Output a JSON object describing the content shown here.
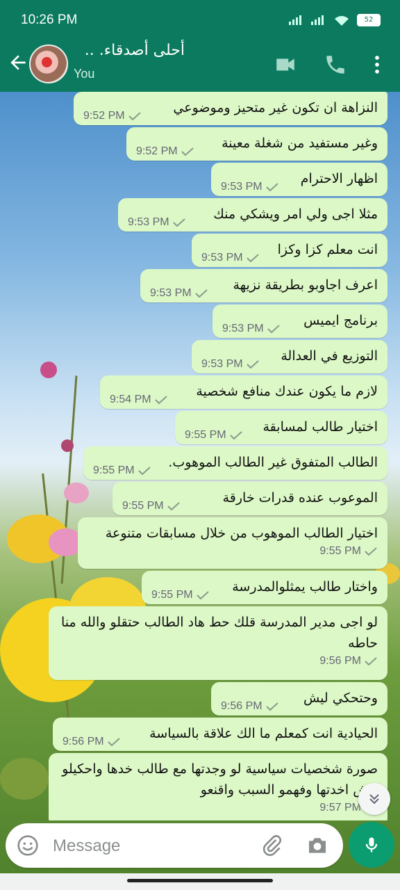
{
  "status": {
    "time": "10:26 PM",
    "battery": "52"
  },
  "header": {
    "title": "أحلى أصدقاء. ..",
    "subtitle": "You"
  },
  "messages": [
    {
      "text": "النزاهة ان تكون غير متحيز وموضوعي",
      "time": "9:52 PM"
    },
    {
      "text": "وغير مستفيد من شغلة معينة",
      "time": "9:52 PM"
    },
    {
      "text": "اظهار الاحترام",
      "time": "9:53 PM"
    },
    {
      "text": "مثلا اجى ولي امر ويشكي منك",
      "time": "9:53 PM"
    },
    {
      "text": "انت معلم كزا وكزا",
      "time": "9:53 PM"
    },
    {
      "text": "اعرف اجاوبو بطريقة نزيهة",
      "time": "9:53 PM"
    },
    {
      "text": "برنامج ايميس",
      "time": "9:53 PM"
    },
    {
      "text": "التوزيع في العدالة",
      "time": "9:53 PM"
    },
    {
      "text": "لازم ما يكون عندك منافع شخصية",
      "time": "9:54 PM"
    },
    {
      "text": "اختيار طالب لمسابقة",
      "time": "9:55 PM"
    },
    {
      "text": "الطالب المتفوق غير الطالب الموهوب.",
      "time": "9:55 PM"
    },
    {
      "text": "الموعوب عنده قدرات خارقة",
      "time": "9:55 PM"
    },
    {
      "text": "اختيار الطالب الموهوب من خلال مسابقات متنوعة",
      "time": "9:55 PM"
    },
    {
      "text": "واختار طالب يمثلوالمدرسة",
      "time": "9:55 PM"
    },
    {
      "text": "لو اجى مدير المدرسة قلك حط هاد الطالب حتقلو والله منا حاطه",
      "time": "9:56 PM"
    },
    {
      "text": "وحتحكي ليش",
      "time": "9:56 PM"
    },
    {
      "text": "الحيادية انت كمعلم ما الك علاقة بالسياسة",
      "time": "9:56 PM"
    },
    {
      "text": "صورة شخصيات سياسية لو وجدتها مع طالب خدها واحكيلو ليش اخدتها وفهمو السبب واقنعو",
      "time": "9:57 PM"
    }
  ],
  "composer": {
    "placeholder": "Message"
  },
  "colors": {
    "header": "#0b7a5e",
    "bubble": "#dcf8c6",
    "mic": "#0b9d6f"
  },
  "icons": [
    "back-arrow-icon",
    "video-call-icon",
    "voice-call-icon",
    "more-vert-icon",
    "emoji-icon",
    "attach-icon",
    "camera-icon",
    "mic-icon",
    "double-chevron-down-icon",
    "read-check-icon"
  ]
}
